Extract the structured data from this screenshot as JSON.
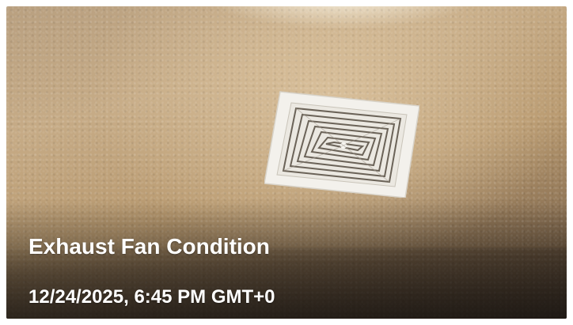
{
  "caption": {
    "title": "Exhaust Fan Condition",
    "timestamp": "12/24/2025, 6:45 PM GMT+0"
  },
  "photo": {
    "subject_icon": "exhaust-fan-vent-icon",
    "wall_color": "#c6ab86",
    "vent_color": "#f2f0ea"
  }
}
